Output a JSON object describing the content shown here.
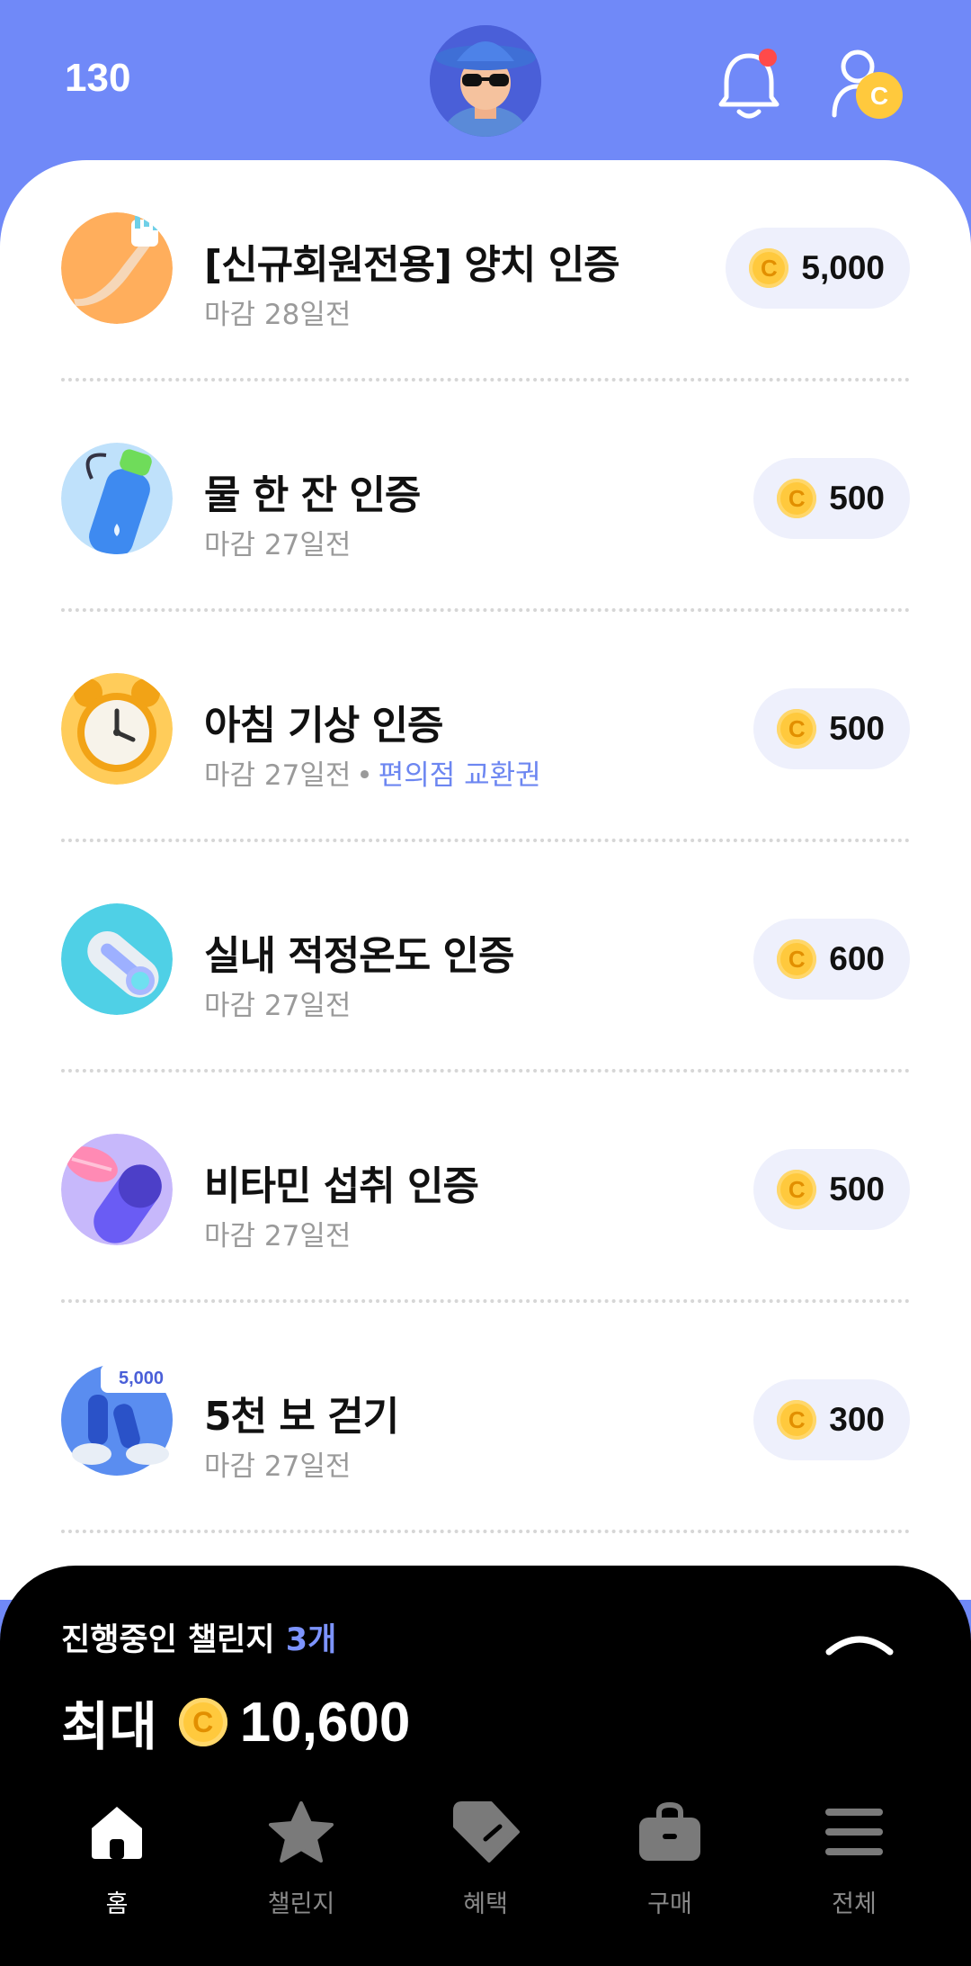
{
  "header": {
    "points": "130",
    "avatar_icon": "avatar-sunglasses-icon",
    "bell_icon": "bell-icon",
    "bell_badge_color": "#ff4a4a",
    "profile_icon": "profile-coin-icon"
  },
  "coin_symbol": "C",
  "challenges": [
    {
      "title": "[신규회원전용] 양치 인증",
      "deadline": "마감 28일전",
      "extra": "",
      "reward": "5,000",
      "icon": "toothbrush-icon"
    },
    {
      "title": "물 한 잔 인증",
      "deadline": "마감 27일전",
      "extra": "",
      "reward": "500",
      "icon": "water-bottle-icon"
    },
    {
      "title": "아침 기상 인증",
      "deadline": "마감 27일전",
      "extra": "편의점 교환권",
      "reward": "500",
      "icon": "alarm-clock-icon"
    },
    {
      "title": "실내 적정온도 인증",
      "deadline": "마감 27일전",
      "extra": "",
      "reward": "600",
      "icon": "thermometer-icon"
    },
    {
      "title": "비타민 섭취 인증",
      "deadline": "마감 27일전",
      "extra": "",
      "reward": "500",
      "icon": "vitamin-pill-icon"
    },
    {
      "title": "5천 보 걷기",
      "deadline": "마감 27일전",
      "extra": "",
      "reward": "300",
      "icon": "walking-shoes-icon",
      "badge": "5,000"
    }
  ],
  "panel": {
    "title": "진행중인 챌린지",
    "count": "3개",
    "max_label": "최대",
    "max_value": "10,600"
  },
  "nav": [
    {
      "label": "홈",
      "icon": "home-icon",
      "active": true
    },
    {
      "label": "챌린지",
      "icon": "star-icon",
      "active": false
    },
    {
      "label": "혜택",
      "icon": "tag-icon",
      "active": false
    },
    {
      "label": "구매",
      "icon": "bag-icon",
      "active": false
    },
    {
      "label": "전체",
      "icon": "menu-icon",
      "active": false
    }
  ],
  "colors": {
    "header_bg": "#7089f8",
    "accent": "#6c86f1",
    "coin": "#ffc93d",
    "pill_bg": "#eef0fc"
  }
}
